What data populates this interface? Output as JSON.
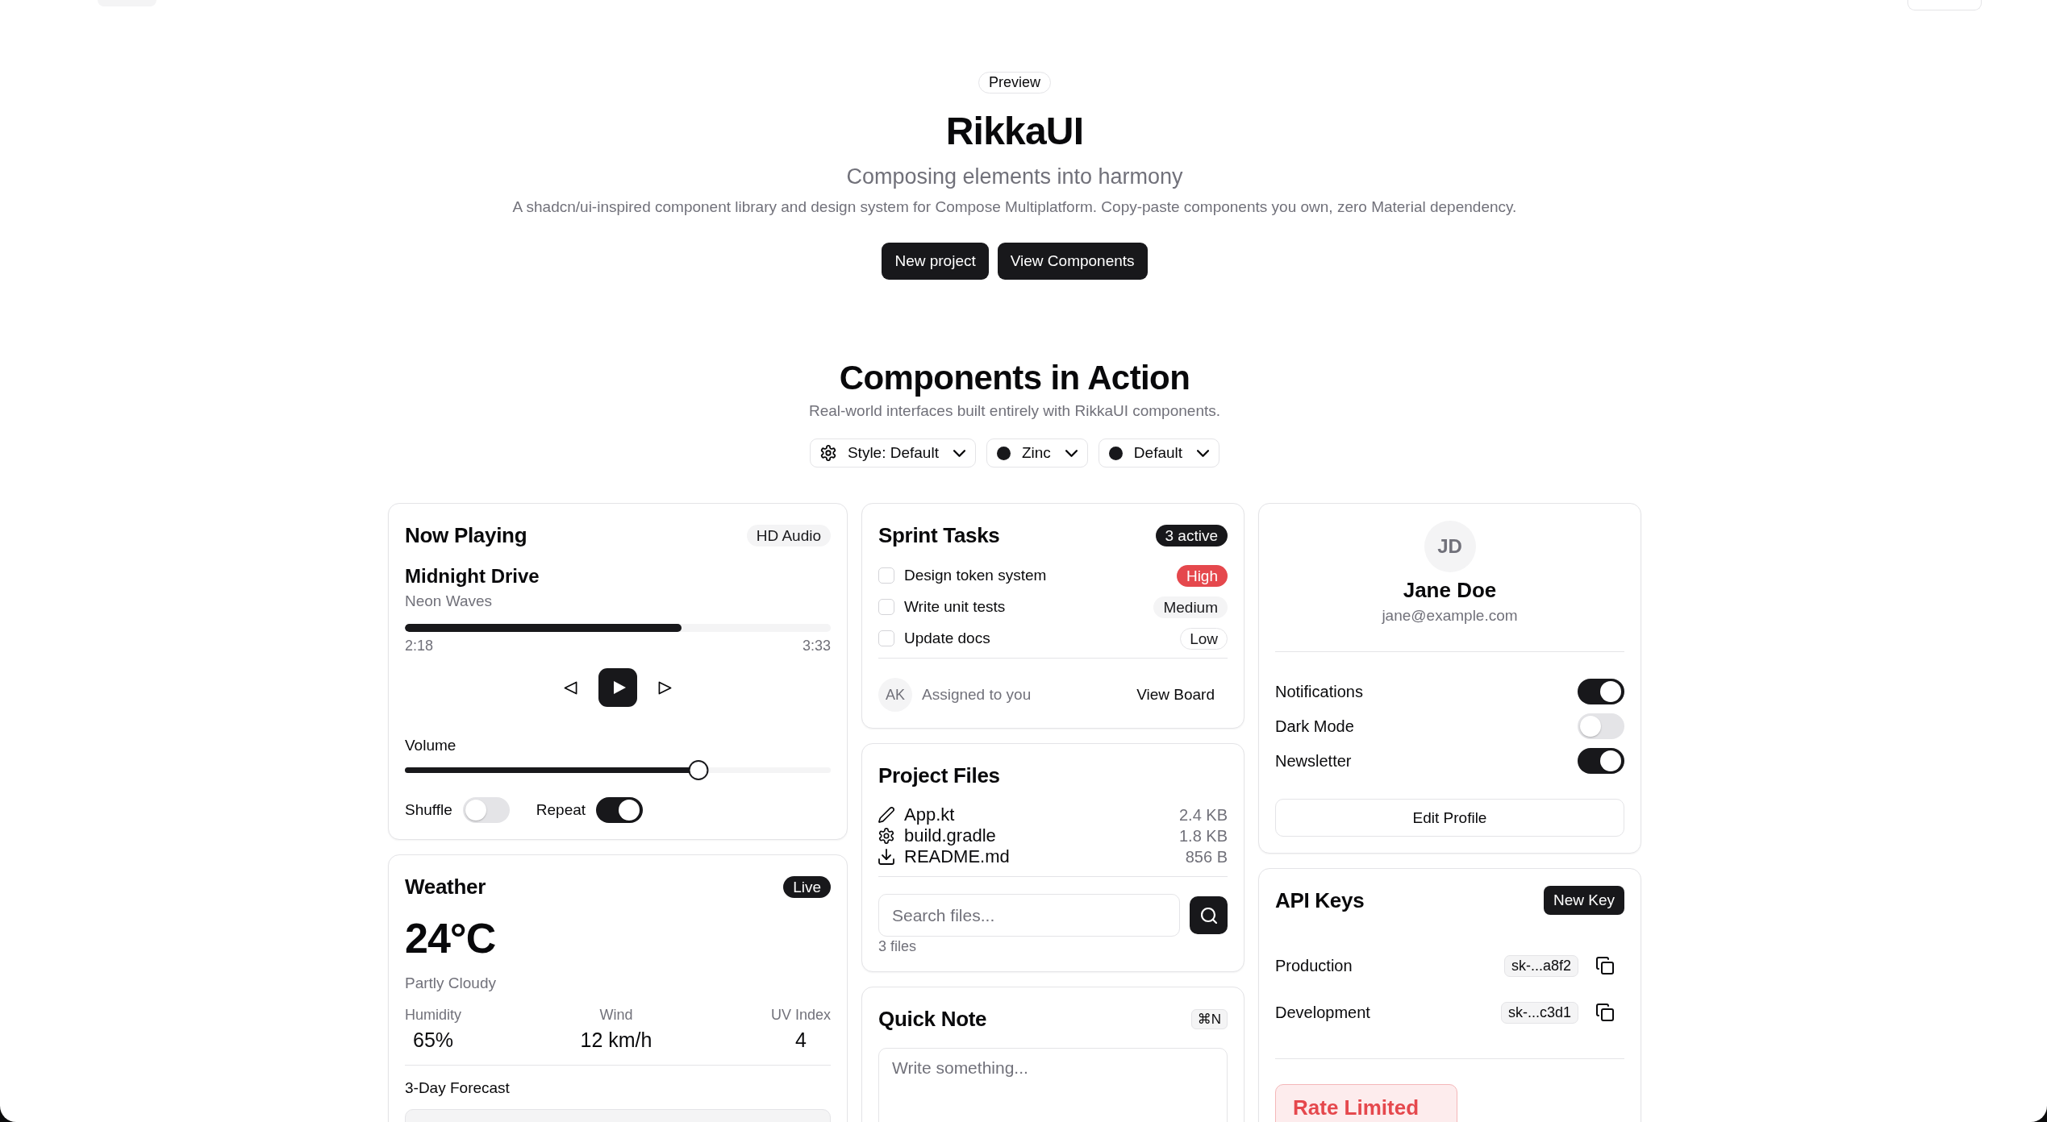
{
  "hero": {
    "badge": "Preview",
    "title": "RikkaUI",
    "subtitle": "Composing elements into harmony",
    "description": "A shadcn/ui-inspired component library and design system for Compose Multiplatform. Copy-paste components you own, zero Material dependency.",
    "buttons": [
      "New project",
      "View Components"
    ]
  },
  "showcase": {
    "title": "Components in Action",
    "subtitle": "Real-world interfaces built entirely with RikkaUI components.",
    "selectors": [
      {
        "kind": "style",
        "label": "Style: Default"
      },
      {
        "kind": "color",
        "label": "Zinc",
        "color": "#18181b"
      },
      {
        "kind": "color",
        "label": "Default",
        "color": "#18181b"
      }
    ]
  },
  "now_playing": {
    "title": "Now Playing",
    "badge": "HD Audio",
    "track": "Midnight Drive",
    "artist": "Neon Waves",
    "progress": {
      "level": 0.65,
      "elapsed": "2:18",
      "duration": "3:33"
    },
    "volume": {
      "label": "Volume",
      "level": 0.69
    },
    "toggles": [
      {
        "label": "Shuffle",
        "on": false
      },
      {
        "label": "Repeat",
        "on": true
      }
    ]
  },
  "weather": {
    "title": "Weather",
    "badge": "Live",
    "temperature": "24°C",
    "condition": "Partly Cloudy",
    "stats": [
      {
        "label": "Humidity",
        "value": "65%"
      },
      {
        "label": "Wind",
        "value": "12 km/h"
      },
      {
        "label": "UV Index",
        "value": "4"
      }
    ],
    "forecast_title": "3-Day Forecast"
  },
  "sprint_tasks": {
    "title": "Sprint Tasks",
    "badge": "3 active",
    "tasks": [
      {
        "label": "Design token system",
        "checked": false,
        "priority": "High",
        "kind": "destructive"
      },
      {
        "label": "Write unit tests",
        "checked": false,
        "priority": "Medium",
        "kind": "secondary"
      },
      {
        "label": "Update docs",
        "checked": false,
        "priority": "Low",
        "kind": "outline"
      }
    ],
    "assignee": {
      "initials": "AK",
      "label": "Assigned to you"
    },
    "action": "View Board"
  },
  "project_files": {
    "title": "Project Files",
    "files": [
      {
        "kind": "source",
        "name": "App.kt",
        "size": "2.4 KB"
      },
      {
        "kind": "build",
        "name": "build.gradle",
        "size": "1.8 KB"
      },
      {
        "kind": "doc",
        "name": "README.md",
        "size": "856 B"
      }
    ],
    "search": {
      "placeholder": "Search files..."
    },
    "count": "3 files"
  },
  "quick_note": {
    "title": "Quick Note",
    "shortcut": "⌘N",
    "placeholder": "Write something..."
  },
  "profile": {
    "initials": "JD",
    "name": "Jane Doe",
    "email": "jane@example.com",
    "settings": [
      {
        "label": "Notifications",
        "on": true
      },
      {
        "label": "Dark Mode",
        "on": false
      },
      {
        "label": "Newsletter",
        "on": true
      }
    ],
    "action": "Edit Profile"
  },
  "api_keys": {
    "title": "API Keys",
    "action": "New Key",
    "keys": [
      {
        "name": "Production",
        "key": "sk-...a8f2"
      },
      {
        "name": "Development",
        "key": "sk-...c3d1"
      }
    ],
    "alert": {
      "title": "Rate Limited"
    }
  }
}
